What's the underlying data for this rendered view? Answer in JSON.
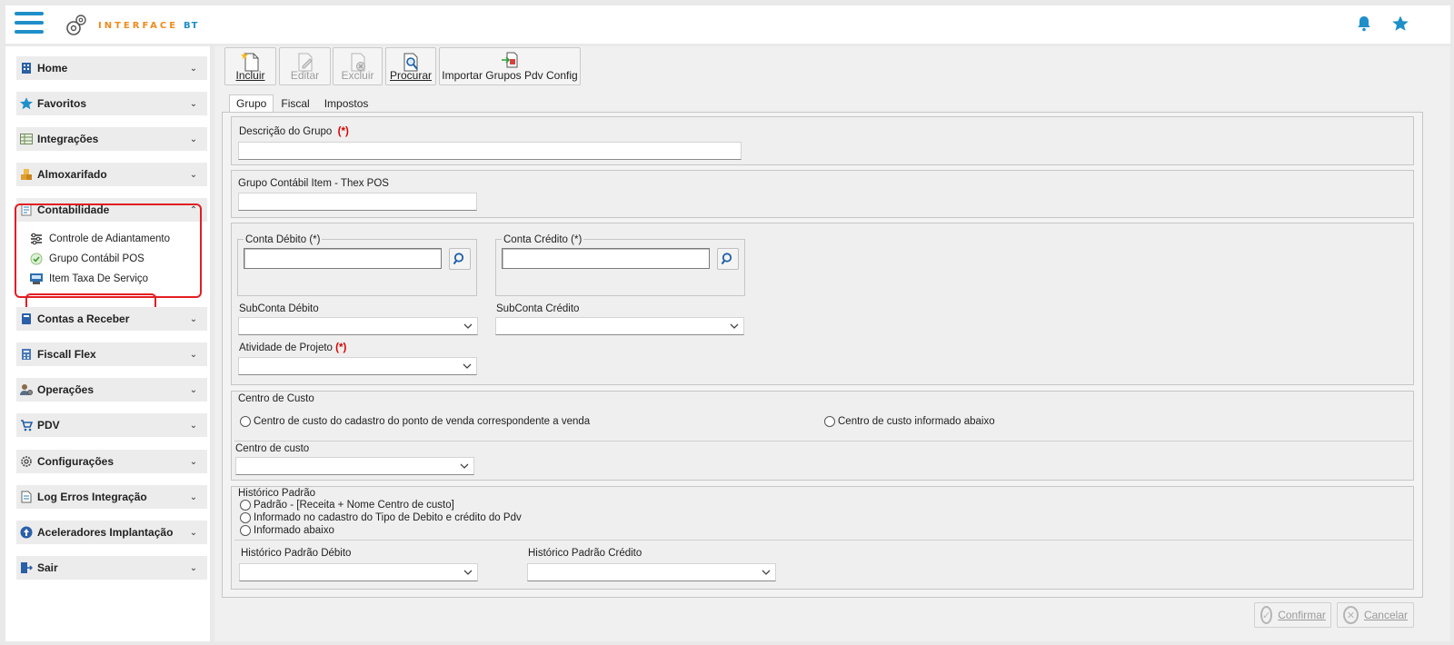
{
  "header": {
    "logo_text": "INTERFACE",
    "logo_suffix": "BT",
    "bell_icon": "bell-icon",
    "star_icon": "star-icon"
  },
  "sidebar": {
    "items": [
      {
        "label": "Home",
        "icon": "building-icon"
      },
      {
        "label": "Favoritos",
        "icon": "star-icon"
      },
      {
        "label": "Integrações",
        "icon": "table-icon"
      },
      {
        "label": "Almoxarifado",
        "icon": "boxes-icon"
      },
      {
        "label": "Contabilidade",
        "icon": "ledger-icon",
        "expanded": true
      },
      {
        "label": "Contas a Receber",
        "icon": "book-icon"
      },
      {
        "label": "Fiscall Flex",
        "icon": "calculator-icon"
      },
      {
        "label": "Operações",
        "icon": "users-gear-icon"
      },
      {
        "label": "PDV",
        "icon": "cart-icon"
      },
      {
        "label": "Configurações",
        "icon": "gear-icon"
      },
      {
        "label": "Log Erros Integração",
        "icon": "log-icon"
      },
      {
        "label": "Aceleradores Implantação",
        "icon": "rocket-icon"
      },
      {
        "label": "Sair",
        "icon": "exit-icon"
      }
    ],
    "subitems": [
      {
        "label": "Controle de Adiantamento",
        "icon": "sliders-icon"
      },
      {
        "label": "Grupo Contábil POS",
        "icon": "check-circle-icon",
        "selected": true
      },
      {
        "label": "Item Taxa De Serviço",
        "icon": "pos-terminal-icon"
      }
    ]
  },
  "toolbar": {
    "incluir": "Incluir",
    "editar": "Editar",
    "excluir": "Excluir",
    "procurar": "Procurar",
    "importar": "Importar Grupos Pdv Config"
  },
  "tabs": [
    "Grupo",
    "Fiscal",
    "Impostos"
  ],
  "form": {
    "descricao_label": "Descrição do Grupo",
    "required_mark": "(*)",
    "descricao_value": "",
    "grupo_contabil_label": "Grupo Contábil Item - Thex POS",
    "grupo_contabil_value": "",
    "conta_debito_label": "Conta Débito (*)",
    "conta_debito_value": "",
    "conta_credito_label": "Conta Crédito (*)",
    "conta_credito_value": "",
    "subconta_debito_label": "SubConta Débito",
    "subconta_credito_label": "SubConta Crédito",
    "atividade_label": "Atividade de Projeto",
    "centro_custo_group": "Centro de Custo",
    "centro_custo_opt1": "Centro de custo do cadastro do ponto de venda correspondente a venda",
    "centro_custo_opt2": "Centro de custo informado abaixo",
    "centro_custo_label": "Centro de custo",
    "historico_group": "Histórico Padrão",
    "historico_opt1": "Padrão - [Receita + Nome Centro de custo]",
    "historico_opt2": "Informado no cadastro do Tipo de Debito e crédito do Pdv",
    "historico_opt3": "Informado abaixo",
    "historico_debito_label": "Histórico Padrão Débito",
    "historico_credito_label": "Histórico Padrão Crédito"
  },
  "footer": {
    "confirmar": "Confirmar",
    "cancelar": "Cancelar"
  },
  "colors": {
    "accent_blue": "#1f8fc9",
    "logo_orange": "#f08a1c",
    "highlight_red": "#e31e24",
    "required_red": "#dd0000"
  }
}
